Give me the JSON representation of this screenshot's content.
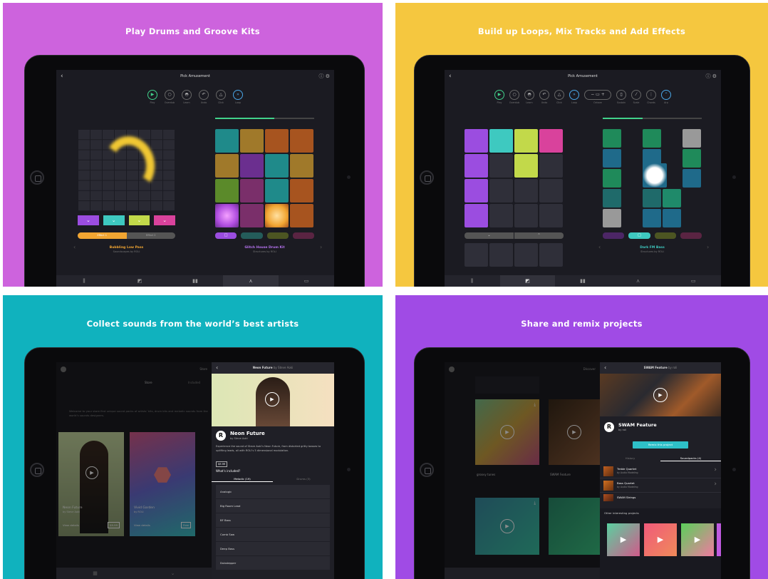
{
  "panels": [
    {
      "caption": "Play Drums and Groove Kits",
      "screen_title": "Pick Amusement",
      "tools": [
        "Play",
        "Overdub",
        "Learn",
        "Undo",
        "Click",
        "Loop"
      ],
      "left_name": "Bubbling Low Pass",
      "left_sub": "Soundscapes by ROLI",
      "right_name": "Glitch House Drum Kit",
      "right_sub": "Structures by ROLI",
      "effect1": "Effect 1",
      "effect2": "Effect 2"
    },
    {
      "caption": "Build up Loops, Mix Tracks and Add Effects",
      "screen_title": "Pick Amusement",
      "tools": [
        "Play",
        "Overdub",
        "Learn",
        "Undo",
        "Click",
        "Loop",
        "Octave",
        "Sustain",
        "Scale",
        "Chords",
        "Arp"
      ],
      "right_name": "Dark FM Bass",
      "right_sub": "Structures by ROLI"
    },
    {
      "caption": "Collect sounds from the world’s best artists",
      "store_label": "Store",
      "store_tab": "Store",
      "purchased_tab": "Included",
      "intro": "Welcome to your store find unique sound packs of artists’ kits, drum kits and melodic sounds from the world’s sounds designers.",
      "card1_title": "Neon Future",
      "card1_sub": "by Steve Aoki",
      "card1_btn": "View details",
      "card1_price": "$9.99",
      "card2_title": "Vivid Garden",
      "card2_sub": "by ROLI",
      "card2_btn": "View details",
      "card2_price": "Free",
      "detail_title": "Neon Future",
      "detail_by": "by Steve Aoki",
      "pack_title": "Neon Future",
      "pack_by": "by Steve Aoki",
      "pack_desc": "Experience the sound of Steve Aoki’s Neon Future, from distorted gritty basses to uplifting leads, all with ROLI’s 5 dimensional modulation.",
      "price": "$9.99",
      "whats_included": "What’s included?",
      "tab_melodic": "Melodic (19)",
      "tab_drums": "Drums (3)",
      "sounds": [
        "Analogic",
        "Big Room Lead",
        "BF Bass",
        "Comb Saw",
        "Deep Bass",
        "Dubstepper"
      ]
    },
    {
      "caption": "Share and remix projects",
      "discover_label": "Discover",
      "card1_title": "groovy tunes",
      "card2_title": "SWAM Feature",
      "detail_title": "SWAM Feature",
      "detail_by": "by roli",
      "project_title": "SWAM Feature",
      "project_by": "by roli",
      "remix_btn": "Remix this project",
      "tab_history": "History",
      "tab_soundpacks": "Soundpacks (4)",
      "soundpacks": [
        {
          "name": "Treble Quartet",
          "by": "by Audio Modeling"
        },
        {
          "name": "Bass Quartet",
          "by": "by Audio Modeling"
        },
        {
          "name": "SWAM Strings",
          "by": ""
        }
      ],
      "other_label": "Other interesting projects"
    }
  ],
  "colors": {
    "green": "#41d28b",
    "purple": "#9b4de0",
    "teal": "#3ec9c0",
    "lime": "#c2d94a",
    "pink": "#d9429c",
    "orange": "#f1a532"
  }
}
